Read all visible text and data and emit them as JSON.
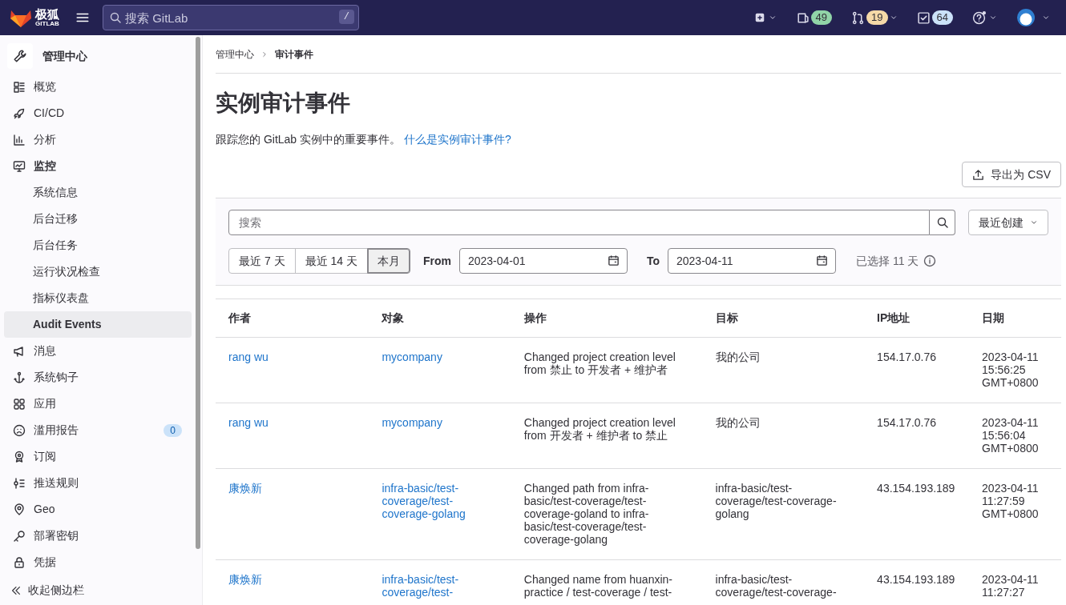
{
  "topbar": {
    "brand": "极狐",
    "brand_sub": "GITLAB",
    "search_placeholder": "搜索 GitLab",
    "search_key": "/",
    "counters": [
      {
        "kind": "issues",
        "count": "49",
        "color": "#91d4a8"
      },
      {
        "kind": "merge",
        "count": "19",
        "color": "#f5d9a8"
      },
      {
        "kind": "todos",
        "count": "64",
        "color": "#cbe2f9"
      }
    ]
  },
  "sidebar": {
    "title": "管理中心",
    "items": [
      {
        "label": "概览",
        "selected": false
      },
      {
        "label": "CI/CD",
        "selected": false
      },
      {
        "label": "分析",
        "selected": false
      },
      {
        "label": "监控",
        "selected": false,
        "expanded": true,
        "children": [
          {
            "label": "系统信息",
            "selected": false
          },
          {
            "label": "后台迁移",
            "selected": false
          },
          {
            "label": "后台任务",
            "selected": false
          },
          {
            "label": "运行状况检查",
            "selected": false
          },
          {
            "label": "指标仪表盘",
            "selected": false
          },
          {
            "label": "Audit Events",
            "selected": true
          }
        ]
      },
      {
        "label": "消息",
        "selected": false
      },
      {
        "label": "系统钩子",
        "selected": false
      },
      {
        "label": "应用",
        "selected": false
      },
      {
        "label": "滥用报告",
        "selected": false,
        "badge": "0"
      },
      {
        "label": "订阅",
        "selected": false
      },
      {
        "label": "推送规则",
        "selected": false
      },
      {
        "label": "Geo",
        "selected": false
      },
      {
        "label": "部署密钥",
        "selected": false
      },
      {
        "label": "凭据",
        "selected": false
      }
    ],
    "collapse": "收起侧边栏"
  },
  "breadcrumb": [
    "管理中心",
    "审计事件"
  ],
  "title": "实例审计事件",
  "description": "跟踪您的 GitLab 实例中的重要事件。",
  "help_link": "什么是实例审计事件?",
  "export_button": "导出为 CSV",
  "filters": {
    "search_placeholder": "搜索",
    "sort": "最近创建",
    "ranges": [
      {
        "label": "最近 7 天",
        "selected": false
      },
      {
        "label": "最近 14 天",
        "selected": false
      },
      {
        "label": "本月",
        "selected": true
      }
    ],
    "from_label": "From",
    "from": "2023-04-01",
    "to_label": "To",
    "to": "2023-04-11",
    "selected_days": "已选择 11 天"
  },
  "table": {
    "columns": [
      "作者",
      "对象",
      "操作",
      "目标",
      "IP地址",
      "日期"
    ],
    "rows": [
      {
        "author": "rang wu",
        "object": "mycompany",
        "action": "Changed project creation level from 禁止 to 开发者 + 维护者",
        "target": "我的公司",
        "ip": "154.17.0.76",
        "date": [
          "2023-04-11",
          "15:56:25",
          "GMT+0800"
        ]
      },
      {
        "author": "rang wu",
        "object": "mycompany",
        "action": "Changed project creation level from 开发者 + 维护者 to 禁止",
        "target": "我的公司",
        "ip": "154.17.0.76",
        "date": [
          "2023-04-11",
          "15:56:04",
          "GMT+0800"
        ]
      },
      {
        "author": "康焕新",
        "object": "infra-basic/test-coverage/test-coverage-golang",
        "action": "Changed path from infra-basic/test-coverage/test-coverage-goland to infra-basic/test-coverage/test-coverage-golang",
        "target": "infra-basic/test-coverage/test-coverage-golang",
        "ip": "43.154.193.189",
        "date": [
          "2023-04-11",
          "11:27:59",
          "GMT+0800"
        ]
      },
      {
        "author": "康焕新",
        "object": "infra-basic/test-coverage/test-",
        "action": "Changed name from huanxin-practice / test-coverage / test-",
        "target": "infra-basic/test-coverage/test-coverage-",
        "ip": "43.154.193.189",
        "date": [
          "2023-04-11",
          "11:27:27"
        ]
      }
    ]
  }
}
